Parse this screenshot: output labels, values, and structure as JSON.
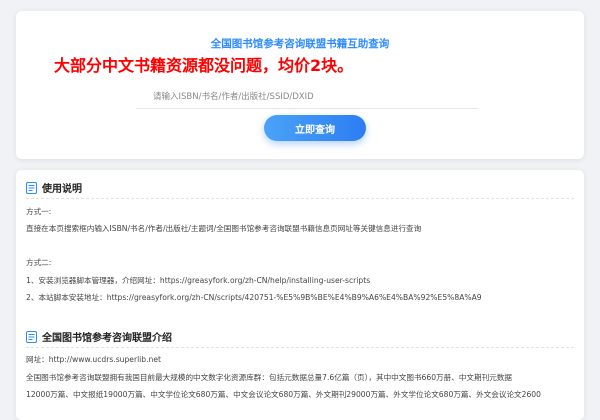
{
  "search": {
    "title": "全国图书馆参考咨询联盟书籍互助查询",
    "promo": "大部分中文书籍资源都没问题，均价2块。",
    "placeholder": "请输入ISBN/书名/作者/出版社/SSID/DXID",
    "button_label": "立即查询"
  },
  "usage": {
    "heading": "使用说明",
    "method1_label": "方式一:",
    "method1_text": "直接在本页搜索框内输入ISBN/书名/作者/出版社/主题词/全国图书馆参考咨询联盟书籍信息页网址等关键信息进行查询",
    "method2_label": "方式二:",
    "step1": "1、安装浏览器脚本管理器，介绍网址：https://greasyfork.org/zh-CN/help/installing-user-scripts",
    "step2": "2、本站脚本安装地址：https://greasyfork.org/zh-CN/scripts/420751-%E5%9B%BE%E4%B9%A6%E4%BA%92%E5%8A%A9"
  },
  "intro": {
    "heading": "全国图书馆参考咨询联盟介绍",
    "url_line": "网址：http://www.ucdrs.superlib.net",
    "desc_line1": "全国图书馆参考咨询联盟拥有我国目前最大规模的中文数字化资源库群：包括元数据总量7.6亿篇（页），其中中文图书660万册、中文期刊元数据",
    "desc_line2": "12000万篇、中文报纸19000万篇、中文学位论文680万篇、中文会议论文680万篇、外文期刊29000万篇、外文学位论文680万篇、外文会议论文2600"
  },
  "colors": {
    "accent": "#2f8cff",
    "promo": "#ff0000",
    "section_icon": "#2f8cff"
  }
}
